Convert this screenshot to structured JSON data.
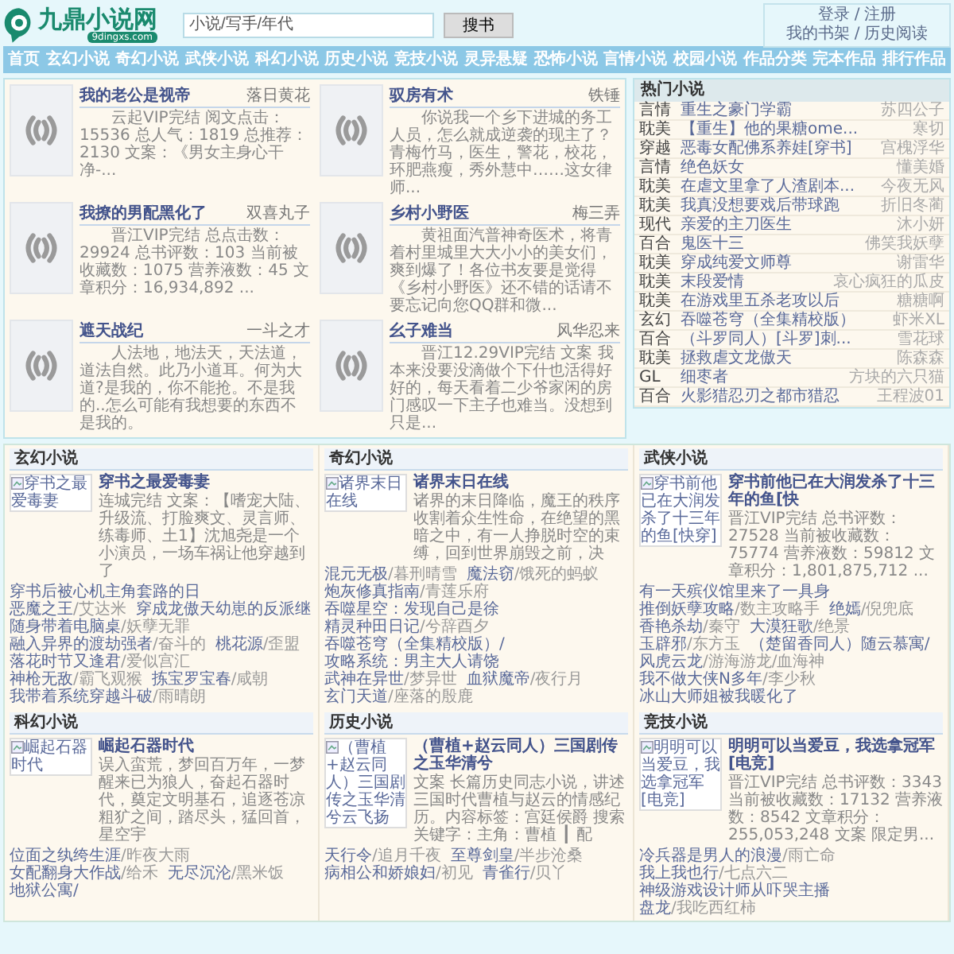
{
  "header": {
    "logo": {
      "name": "九鼎小说网",
      "domain": "9dingxs.com"
    },
    "search": {
      "placeholder": "小说/写手/年代",
      "button": "搜书"
    },
    "account": [
      {
        "links": [
          "登录",
          "注册"
        ]
      },
      {
        "links": [
          "我的书架",
          "历史阅读"
        ]
      }
    ],
    "separator": "/"
  },
  "nav": [
    "首页",
    "玄幻小说",
    "奇幻小说",
    "武侠小说",
    "科幻小说",
    "历史小说",
    "竞技小说",
    "灵异悬疑",
    "恐怖小说",
    "言情小说",
    "校园小说",
    "作品分类",
    "完本作品",
    "排行作品"
  ],
  "featured": [
    {
      "title": "我的老公是视帝",
      "author": "落日黄花",
      "summary": "云起VIP完结 阅文点击：15536 总人气：1819 总推荐：2130 文案：《男女主身心干净-..."
    },
    {
      "title": "驭房有术",
      "author": "铁锤",
      "summary": "你说我一个乡下进城的务工人员，怎么就成逆袭的现主了？青梅竹马，医生，警花，校花，环肥燕瘦，秀外慧中……这女律师..."
    },
    {
      "title": "我撩的男配黑化了",
      "author": "双喜丸子",
      "summary": "晋江VIP完结 总点击数：29924 总书评数：103 当前被收藏数：1075 营养液数：45 文章积分：16,934,892 ..."
    },
    {
      "title": "乡村小野医",
      "author": "梅三弄",
      "summary": "黄祖面汽普神奇医术，将青着村里城里大大小小的美女们，爽到爆了！各位书友要是觉得《乡村小野医》还不错的话请不要忘记向您QQ群和微..."
    },
    {
      "title": "遮天战纪",
      "author": "一斗之才",
      "summary": "人法地，地法天，天法道，道法自然。此乃小道耳。何为大道?是我的，你不能抢。不是我的..怎么可能有我想要的东西不是我的。"
    },
    {
      "title": "幺子难当",
      "author": "风华忍来",
      "summary": "晋江12.29VIP完结 文案 我本来没要没滴做个下什也活得好好的，每天看着二少爷家闲的房门感叹一下主子也难当。没想到只是..."
    }
  ],
  "hot": {
    "title": "热门小说",
    "rows": [
      {
        "category": "言情",
        "title": "重生之豪门学霸",
        "author": "苏四公子"
      },
      {
        "category": "耽美",
        "title": "【重生】他的果糖ome...",
        "author": "寒切"
      },
      {
        "category": "穿越",
        "title": "恶毒女配佛系养娃[穿书]",
        "author": "宫槐浮华"
      },
      {
        "category": "言情",
        "title": "绝色妖女",
        "author": "懂美婚"
      },
      {
        "category": "耽美",
        "title": "在虐文里拿了人渣剧本...",
        "author": "今夜无风"
      },
      {
        "category": "耽美",
        "title": "我真没想要戏后带球跑",
        "author": "折旧冬蔺"
      },
      {
        "category": "现代",
        "title": "亲爱的主刀医生",
        "author": "沐小妍"
      },
      {
        "category": "百合",
        "title": "鬼医十三",
        "author": "佛笑我妖孽"
      },
      {
        "category": "耽美",
        "title": "穿成纯爱文师尊",
        "author": "谢雷华"
      },
      {
        "category": "耽美",
        "title": "末段爱情",
        "author": "哀心疯狂的瓜皮"
      },
      {
        "category": "耽美",
        "title": "在游戏里五杀老攻以后",
        "author": "糖糖啊"
      },
      {
        "category": "玄幻",
        "title": "吞噬苍穹（全集精校版）",
        "author": "虾米XL"
      },
      {
        "category": "百合",
        "title": "（斗罗同人）[斗罗]刺...",
        "author": "雪花球"
      },
      {
        "category": "耽美",
        "title": "拯救虐文龙傲天",
        "author": "陈森森"
      },
      {
        "category": "GL",
        "title": "细枣者",
        "author": "方块的六只猫"
      },
      {
        "category": "百合",
        "title": "火影猎忍刃之都市猎忍",
        "author": "王程波01"
      }
    ]
  },
  "link_separator": "/",
  "sections": [
    {
      "title": "玄幻小说",
      "feature": {
        "cover_text": "穿书之最爱毒妻",
        "title": "穿书之最爱毒妻",
        "summary": "连城完结 文案：【嗜宠大陆、升级流、打脸爽文、灵言师、练毒师、土1】沈旭尧是一个小演员，一场车祸让他穿越到了"
      },
      "links": [
        {
          "title": "穿书后被心机主角套路的日"
        },
        {
          "title": "恶魔之王",
          "author": "艾达米"
        },
        {
          "title": "穿成龙傲天幼崽的反派继"
        },
        {
          "title": "随身带着电脑桌",
          "author": "妖孽无罪"
        },
        {
          "title": "融入异界的渡劫强者",
          "author": "奋斗的"
        },
        {
          "title": "桃花源",
          "author": "歪盟"
        },
        {
          "title": "落花时节又逢君",
          "author": "爱似宫汇"
        },
        {
          "title": "神枪无敌",
          "author": "霸飞观猴"
        },
        {
          "title": "拣宝罗宝春",
          "author": "咸朝"
        },
        {
          "title": "我带着系统穿越斗破",
          "author": "雨晴朗"
        }
      ]
    },
    {
      "title": "奇幻小说",
      "feature": {
        "cover_text": "诸界末日在线",
        "title": "诸界末日在线",
        "summary": "诸界的末日降临，魔王的秩序收割着众生性命，在绝望的黑暗之中，有一人挣脱时空的束缚，回到世界崩毁之前，决"
      },
      "links": [
        {
          "title": "混元无极",
          "author": "暮刑晴雪"
        },
        {
          "title": "魔法窃",
          "author": "饿死的蚂蚁"
        },
        {
          "title": "炮灰修真指南",
          "author": "青莲乐府"
        },
        {
          "title": "吞噬星空：发现自己是徐"
        },
        {
          "title": "精灵种田日记",
          "author": "兮辞酉夕"
        },
        {
          "title": "吞噬苍穹（全集精校版）/"
        },
        {
          "title": "攻略系统：男主大人请饶"
        },
        {
          "title": "武神在异世",
          "author": "梦异世"
        },
        {
          "title": "血狱魔帝",
          "author": "夜行月"
        },
        {
          "title": "玄门天道",
          "author": "座落的殷鹿"
        }
      ]
    },
    {
      "title": "武侠小说",
      "feature": {
        "cover_text": "穿书前他已在大润发杀了十三年的鱼[快穿]",
        "title": "穿书前他已在大润发杀了十三年的鱼[快",
        "summary": "晋江VIP完结 总书评数：27528 当前被收藏数：75774 营养液数：59812 文章积分：1,801,875,712 ..."
      },
      "links": [
        {
          "title": "有一天殡仪馆里来了一具身"
        },
        {
          "title": "推倒妖孽攻略",
          "author": "数主攻略手"
        },
        {
          "title": "绝嫣",
          "author": "倪兜底"
        },
        {
          "title": "香艳杀劫",
          "author": "秦守"
        },
        {
          "title": "大漠狂歌",
          "author": "绝景"
        },
        {
          "title": "玉辟邪",
          "author": "东方玉"
        },
        {
          "title": "（楚留香同人）随云慕寓/"
        },
        {
          "title": "风虎云龙",
          "author": "游海游龙/血海神"
        },
        {
          "title": "我不做大侠N多年",
          "author": "李少秋"
        },
        {
          "title": "冰山大师姐被我暖化了"
        }
      ]
    },
    {
      "title": "科幻小说",
      "feature": {
        "cover_text": "崛起石器时代",
        "title": "崛起石器时代",
        "summary": "误入蛮荒，梦回百万年，一梦醒来已为狼人，奋起石器时代，奠定文明基石，追逐苍凉粗犷之间，踏尽头，猛回首，星空宇"
      },
      "links": [
        {
          "title": "位面之纨绔生涯",
          "author": "昨夜大雨"
        },
        {
          "title": "女配翻身大作战",
          "author": "给禾"
        },
        {
          "title": "无尽沉沦",
          "author": "黑米饭"
        },
        {
          "title": "地狱公寓/"
        }
      ]
    },
    {
      "title": "历史小说",
      "feature": {
        "cover_text": "（曹植+赵云同人）三国剧传之玉华清兮云飞扬",
        "title": "（曹植+赵云同人）三国剧传之玉华清兮",
        "summary": "文案 长篇历史同志小说，讲述三国时代曹植与赵云的情感纪历。内容标签：宫廷侯爵 搜索关键字：主角：曹植 ┃ 配"
      },
      "links": [
        {
          "title": "天行令",
          "author": "追月千夜"
        },
        {
          "title": "至尊剑皇",
          "author": "半步沧桑"
        },
        {
          "title": "病相公和娇娘妇",
          "author": "初见"
        },
        {
          "title": "青雀行",
          "author": "贝丫"
        }
      ]
    },
    {
      "title": "竞技小说",
      "feature": {
        "cover_text": "明明可以当爱豆，我选拿冠军[电竞]",
        "title": "明明可以当爱豆，我选拿冠军[电竞]",
        "summary": "晋江VIP完结 总书评数：3343 当前被收藏数：17132 营养液数：8542 文章积分：255,053,248 文案 限定男..."
      },
      "links": [
        {
          "title": "冷兵器是男人的浪漫",
          "author": "雨亡命"
        },
        {
          "title": "我上我也行",
          "author": "七点六二"
        },
        {
          "title": "神级游戏设计师从吓哭主播"
        },
        {
          "title": "盘龙",
          "author": "我吃西红柿"
        }
      ]
    }
  ]
}
